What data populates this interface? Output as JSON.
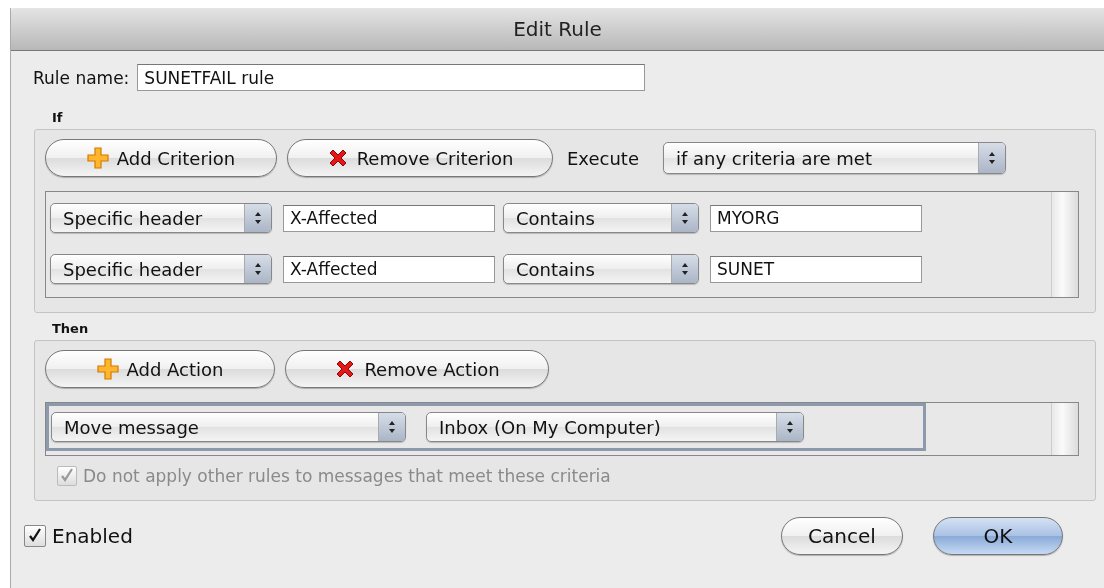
{
  "window": {
    "title": "Edit Rule"
  },
  "rule_name": {
    "label": "Rule name:",
    "value": "SUNETFAIL rule"
  },
  "if_section": {
    "label": "If",
    "buttons": [
      {
        "label": "Add Criterion",
        "kind": "add"
      },
      {
        "label": "Remove Criterion",
        "kind": "remove"
      }
    ],
    "execute": {
      "label": "Execute",
      "value": "if any criteria are met"
    },
    "criteria": [
      {
        "field": "Specific header",
        "header": "X-Affected",
        "operator": "Contains",
        "value": "MYORG"
      },
      {
        "field": "Specific header",
        "header": "X-Affected",
        "operator": "Contains",
        "value": "SUNET"
      }
    ]
  },
  "then_section": {
    "label": "Then",
    "buttons": [
      {
        "label": "Add Action",
        "kind": "add"
      },
      {
        "label": "Remove Action",
        "kind": "remove"
      }
    ],
    "actions": [
      {
        "action": "Move message",
        "target": "Inbox (On My Computer)"
      }
    ],
    "stop_rules": {
      "label": "Do not apply other rules to messages that meet these criteria",
      "checked": true,
      "disabled": true
    }
  },
  "enabled": {
    "label": "Enabled",
    "checked": true
  },
  "buttons": [
    {
      "label": "Cancel",
      "kind": "cancel"
    },
    {
      "label": "OK",
      "kind": "default"
    }
  ]
}
